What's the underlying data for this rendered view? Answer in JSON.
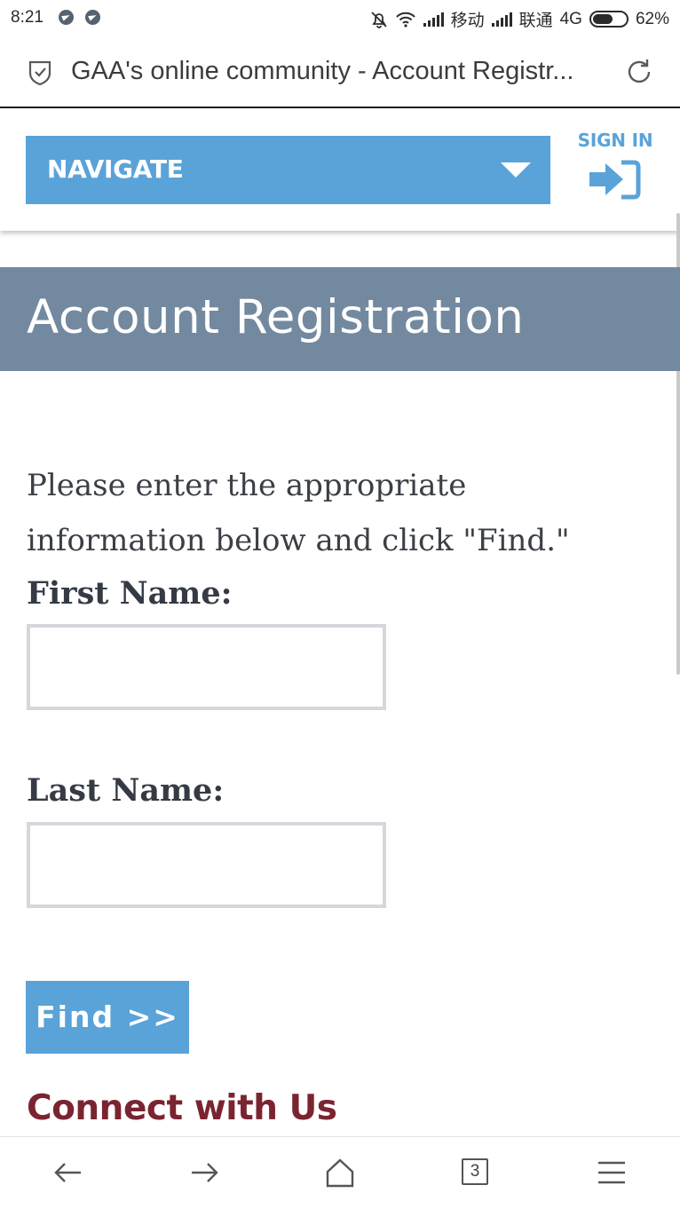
{
  "status_bar": {
    "time": "8:21",
    "carrier1": "移动",
    "carrier2": "联通",
    "network": "4G",
    "battery": "62%",
    "battery_level": 0.62,
    "icons": [
      "telegram-icon",
      "telegram-icon",
      "mute-icon",
      "wifi-icon",
      "signal-icon",
      "signal-icon",
      "battery-icon"
    ]
  },
  "browser": {
    "page_title": "GAA's online community - Account Registr...",
    "tab_count": "3",
    "icons": [
      "shield-icon",
      "reload-icon",
      "back-icon",
      "forward-icon",
      "home-icon",
      "tabs-icon",
      "menu-icon"
    ]
  },
  "header": {
    "nav_label": "NAVIGATE",
    "sign_in_label": "SIGN IN",
    "accent_color": "#59a3d9"
  },
  "banner": {
    "title": "Account Registration",
    "color": "#7389a0"
  },
  "form": {
    "intro": "Please enter the appropriate information below and click \"Find.\"",
    "first_name_label": "First Name:",
    "first_name_value": "",
    "last_name_label": "Last Name:",
    "last_name_value": "",
    "find_label": "Find >>"
  },
  "footer": {
    "connect_heading": "Connect with Us",
    "heading_color": "#7b2431"
  }
}
